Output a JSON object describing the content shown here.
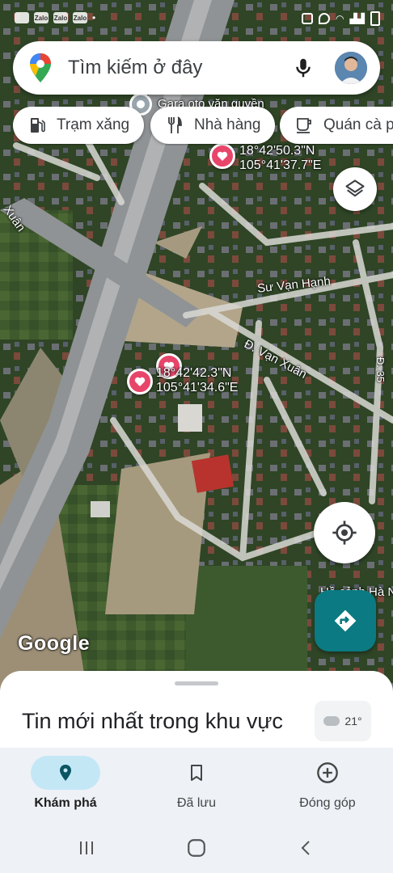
{
  "search": {
    "placeholder": "Tìm kiếm ở đây"
  },
  "chips": [
    {
      "label": "Trạm xăng",
      "icon": "gas-station-icon"
    },
    {
      "label": "Nhà hàng",
      "icon": "restaurant-icon"
    },
    {
      "label": "Quán cà phê",
      "icon": "coffee-icon"
    }
  ],
  "map": {
    "place_label": "Gara oto văn quyền",
    "pins": [
      {
        "lat": "18°42'50.3\"N",
        "lng": "105°41'37.7\"E"
      },
      {
        "lat": "18°42'42.3\"N",
        "lng": "105°41'34.6\"E"
      }
    ],
    "road_labels": {
      "su_van_hanh": "Sư Vạn Hạnh",
      "van_xuan": "Đ. Vạn Xuân",
      "d35": "Đ. 35",
      "xuan": "Xuân",
      "ho": "Hồ cảnh Hà Ng"
    },
    "google_logo": "Google"
  },
  "sheet": {
    "title": "Tin mới nhất trong khu vực",
    "weather": "21°"
  },
  "bottom_nav": [
    {
      "label": "Khám phá",
      "icon": "explore-pin-icon",
      "active": true
    },
    {
      "label": "Đã lưu",
      "icon": "bookmark-icon",
      "active": false
    },
    {
      "label": "Đóng góp",
      "icon": "add-circle-icon",
      "active": false
    }
  ],
  "colors": {
    "accent": "#0b7a82",
    "heart_pin": "#e8456a",
    "nav_active": "#c4e7f6"
  }
}
